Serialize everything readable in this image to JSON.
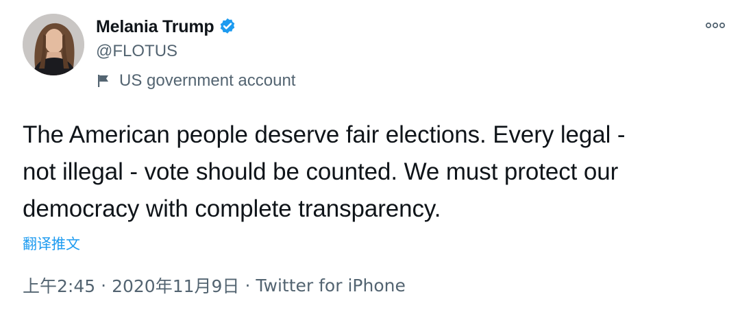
{
  "author": {
    "display_name": "Melania Trump",
    "handle": "@FLOTUS",
    "verified": true,
    "avatar": "profile-photo"
  },
  "label": {
    "icon": "flag-icon",
    "text": "US government account"
  },
  "tweet": {
    "text": "The American people deserve fair elections. Every legal -\nnot illegal - vote should be counted. We must protect our\ndemocracy with complete transparency.",
    "translate_label": "翻译推文",
    "time": "上午2:45",
    "date": "2020年11月9日",
    "separator": "·",
    "source": "Twitter for iPhone"
  },
  "icons": {
    "more": "more-options-icon",
    "verified": "verified-badge-icon"
  },
  "colors": {
    "accent": "#1d9bf0",
    "secondary_text": "#536471",
    "primary_text": "#0f1419"
  }
}
